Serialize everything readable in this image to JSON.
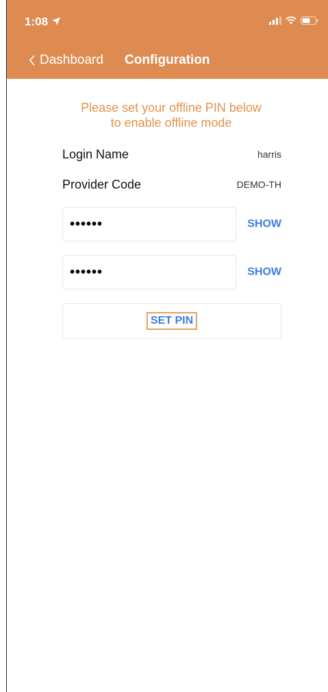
{
  "status_bar": {
    "time": "1:08",
    "icons": [
      "location-arrow-icon",
      "signal-icon",
      "wifi-icon",
      "battery-icon"
    ]
  },
  "nav": {
    "back_label": "Dashboard",
    "title": "Configuration"
  },
  "message": {
    "line1": "Please set your offline PIN below",
    "line2": "to enable offline mode"
  },
  "info": {
    "login_name_label": "Login Name",
    "login_name_value": "harris",
    "provider_code_label": "Provider Code",
    "provider_code_value": "DEMO-TH"
  },
  "pin": {
    "field1_value": "••••••",
    "field2_value": "••••••",
    "show_label": "SHOW"
  },
  "actions": {
    "set_pin_label": "SET PIN"
  },
  "colors": {
    "header_bg": "#de8b52",
    "message_text": "#e3924d",
    "link_blue": "#3b7de0",
    "focus_outline": "#e8a060"
  }
}
